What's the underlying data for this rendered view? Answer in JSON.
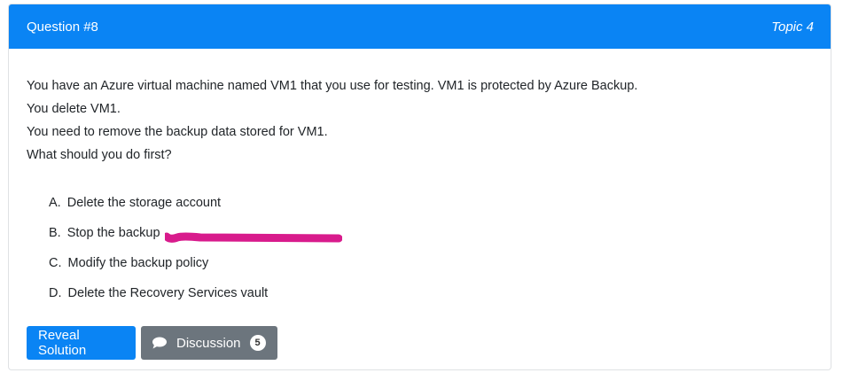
{
  "header": {
    "question_number": "Question #8",
    "topic": "Topic 4"
  },
  "question": {
    "lines": [
      "You have an Azure virtual machine named VM1 that you use for testing. VM1 is protected by Azure Backup.",
      "You delete VM1.",
      "You need to remove the backup data stored for VM1.",
      "What should you do first?"
    ]
  },
  "choices": [
    {
      "letter": "A.",
      "text": "Delete the storage account"
    },
    {
      "letter": "B.",
      "text": "Stop the backup"
    },
    {
      "letter": "C.",
      "text": "Modify the backup policy"
    },
    {
      "letter": "D.",
      "text": "Delete the Recovery Services vault"
    }
  ],
  "buttons": {
    "reveal_label": "Reveal Solution",
    "discussion_label": "Discussion",
    "discussion_count": "5"
  },
  "colors": {
    "accent": "#0a84f4",
    "secondary": "#6c757d",
    "highlight_mark": "#d81b8c"
  },
  "icons": {
    "discussion": "chat-bubble-icon"
  }
}
